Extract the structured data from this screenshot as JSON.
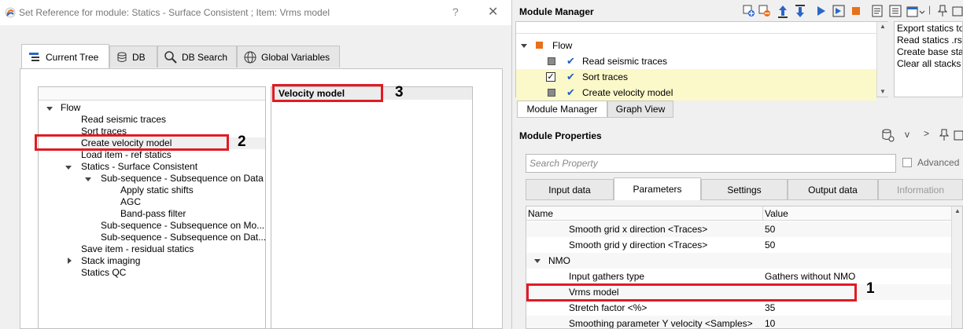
{
  "dialog": {
    "title": "Set Reference for module: Statics - Surface Consistent ; Item: Vrms model",
    "help": "?",
    "close": "✕",
    "tabs": [
      {
        "label": "Current Tree",
        "icon": "tree-icon"
      },
      {
        "label": "DB",
        "icon": "database-icon"
      },
      {
        "label": "DB Search",
        "icon": "search-icon"
      },
      {
        "label": "Global Variables",
        "icon": "globe-icon"
      }
    ],
    "tree": [
      "Flow",
      "Read seismic traces",
      "Sort traces",
      "Create velocity model",
      "Load item - ref statics",
      "Statics - Surface Consistent",
      "Sub-sequence - Subsequence on Data",
      "Apply static shifts",
      "AGC",
      "Band-pass filter",
      "Sub-sequence - Subsequence on Mo...",
      "Sub-sequence - Subsequence on Dat...",
      "Save item - residual statics",
      "Stack imaging",
      "Statics QC"
    ],
    "list_item": "Velocity model"
  },
  "callouts": [
    "1",
    "2",
    "3"
  ],
  "module_manager": {
    "title": "Module Manager",
    "tree": {
      "root": "Flow",
      "items": [
        "Read seismic traces",
        "Sort traces",
        "Create velocity model"
      ]
    },
    "side_list": [
      "Export statics to",
      "Read statics .rsta",
      "Create base stac",
      "Clear all stacks"
    ],
    "bottom_tabs": [
      "Module Manager",
      "Graph View"
    ]
  },
  "module_properties": {
    "title": "Module Properties",
    "search_placeholder": "Search Property",
    "advanced_label": "Advanced",
    "tabs": [
      "Input data",
      "Parameters",
      "Settings",
      "Output data",
      "Information"
    ],
    "columns": [
      "Name",
      "Value"
    ],
    "rows": [
      {
        "name": "Smooth grid x direction  <Traces>",
        "value": "50"
      },
      {
        "name": "Smooth grid y direction  <Traces>",
        "value": "50"
      },
      {
        "name": "NMO",
        "value": ""
      },
      {
        "name": "Input gathers type",
        "value": "Gathers without NMO"
      },
      {
        "name": "Vrms model",
        "value": ""
      },
      {
        "name": "Stretch factor <%>",
        "value": "35"
      },
      {
        "name": "Smoothing parameter Y velocity <Samples>",
        "value": "10"
      }
    ]
  },
  "colors": {
    "highlight": "#e01b24",
    "selected_row": "#fbf8c9",
    "flow_icon": "#e8701a",
    "check_blue": "#1f5fbf"
  }
}
